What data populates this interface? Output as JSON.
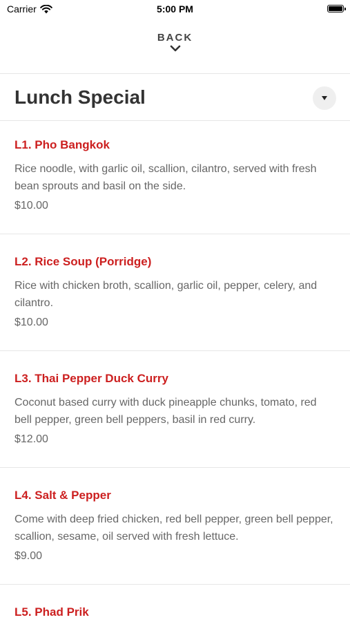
{
  "status_bar": {
    "carrier": "Carrier",
    "time": "5:00 PM",
    "battery_level": 1.0
  },
  "nav": {
    "back_label": "BACK"
  },
  "section": {
    "title": "Lunch Special"
  },
  "items": [
    {
      "name": "L1. Pho Bangkok",
      "description": "Rice noodle, with garlic oil, scallion, cilantro, served with fresh bean sprouts and basil on the side.",
      "price": "$10.00"
    },
    {
      "name": "L2. Rice Soup (Porridge)",
      "description": "Rice with chicken broth, scallion, garlic oil, pepper, celery, and cilantro.",
      "price": "$10.00"
    },
    {
      "name": "L3. Thai Pepper Duck Curry",
      "description": "Coconut based curry with duck pineapple chunks, tomato, red bell pepper, green bell peppers, basil in red curry.",
      "price": "$12.00"
    },
    {
      "name": "L4. Salt & Pepper",
      "description": "Come with deep fried chicken, red bell pepper, green bell pepper, scallion, sesame, oil served with fresh lettuce.",
      "price": "$9.00"
    },
    {
      "name": "L5. Phad Prik",
      "description": "",
      "price": ""
    }
  ]
}
